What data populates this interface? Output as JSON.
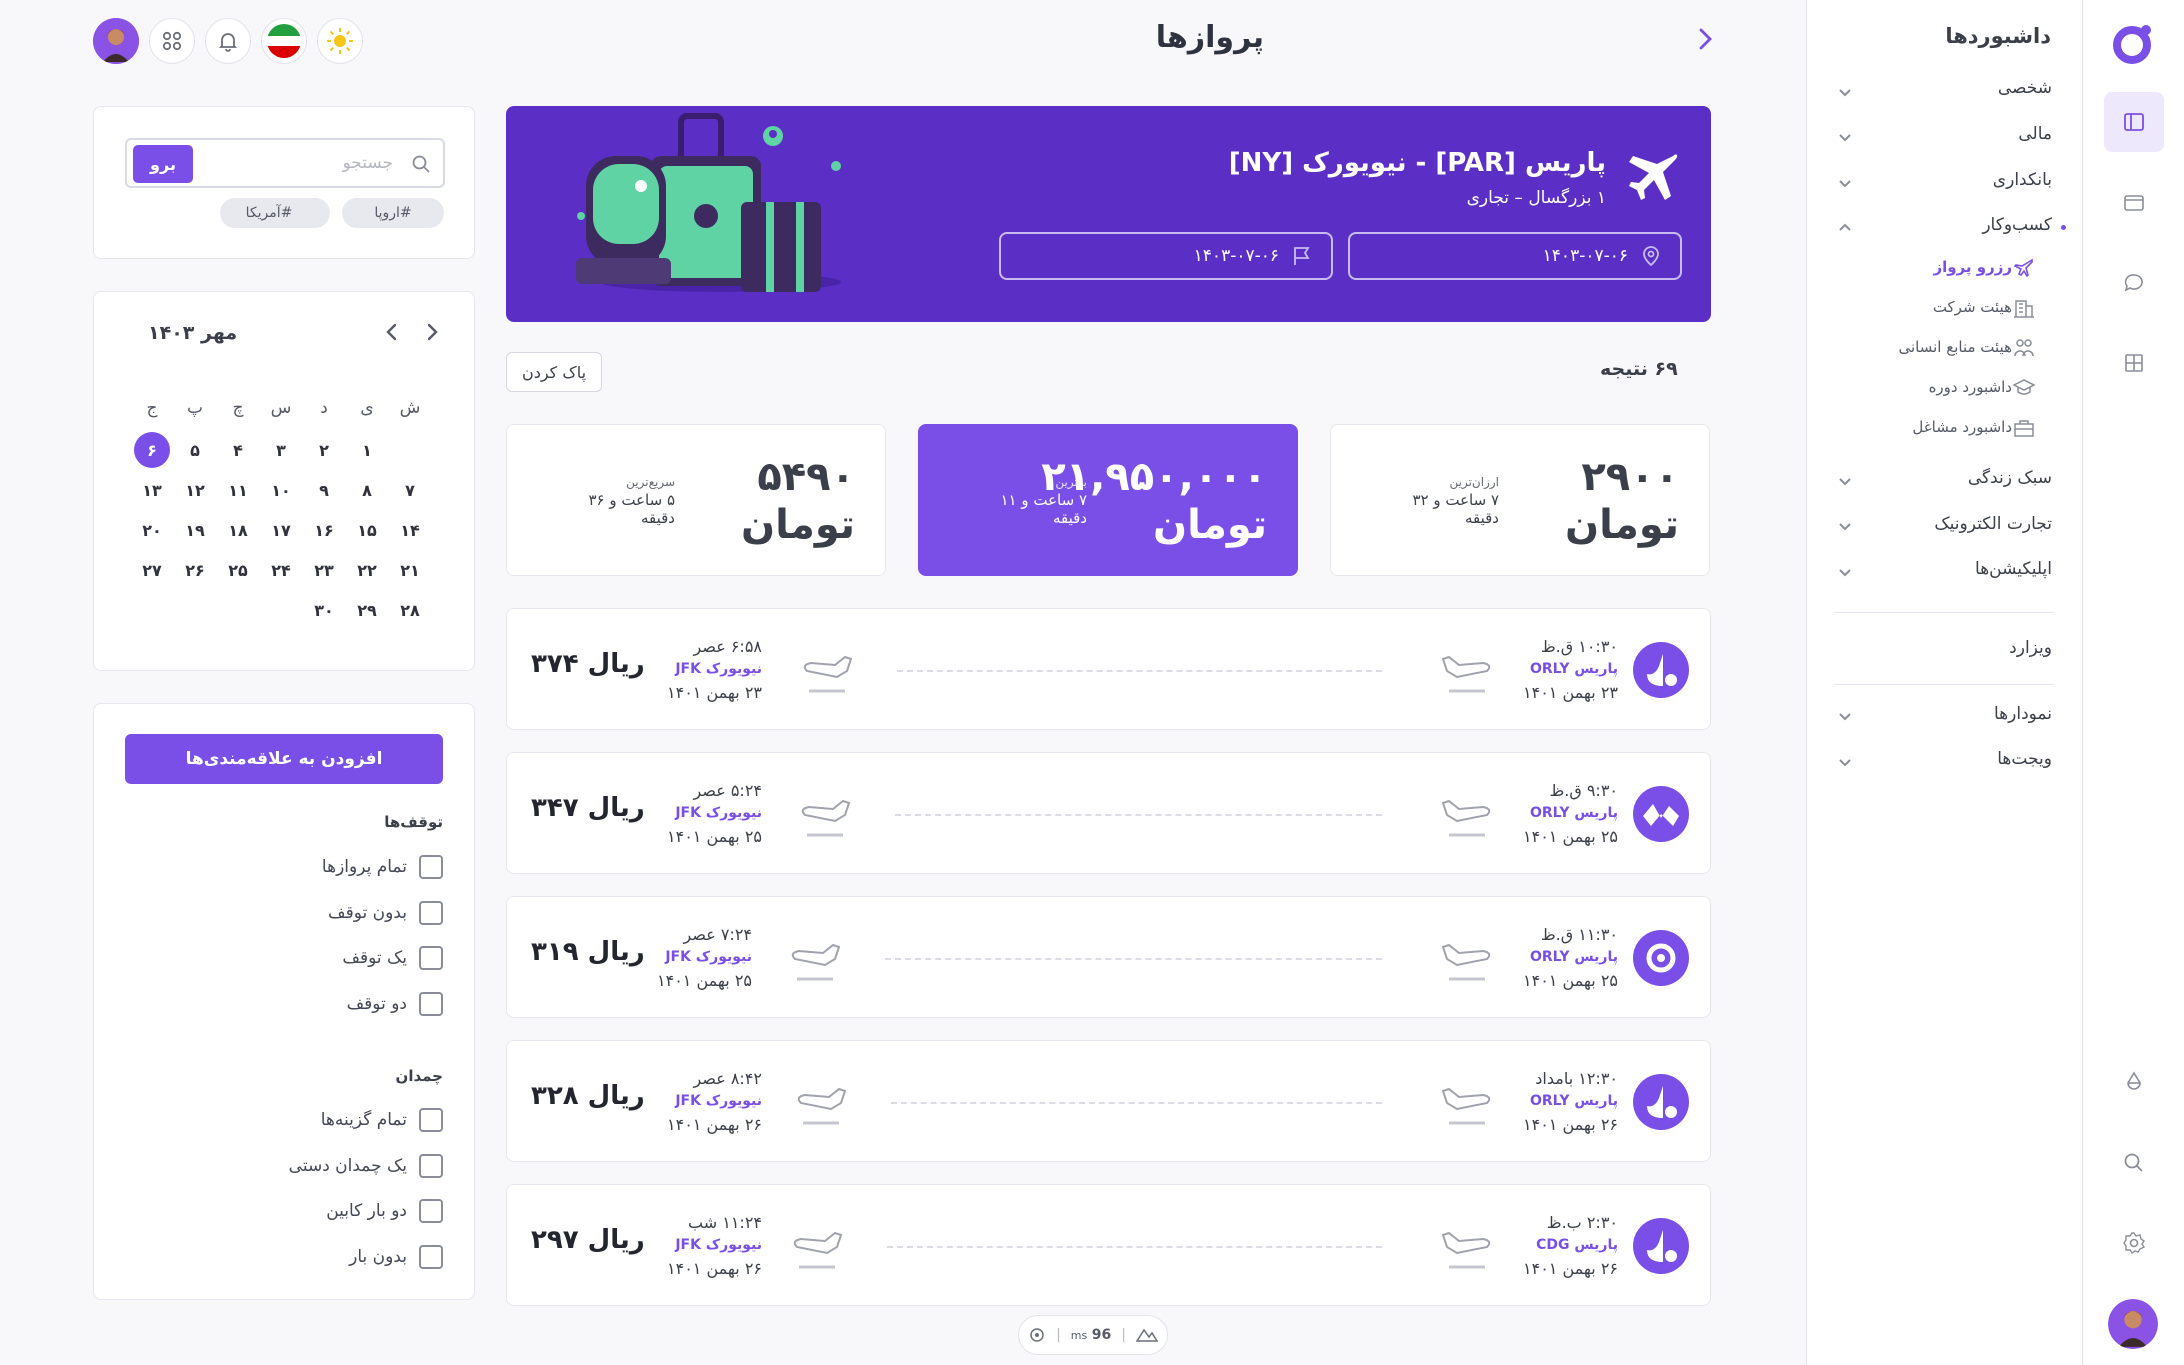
{
  "page_title": "پروازها",
  "banner": {
    "route": "پاریس [PAR] - نیویورک [NY]",
    "passengers": "۱ بزرگسال – تجاری",
    "depart_date": "۱۴۰۳-۰۷-۰۶",
    "return_date": "۱۴۰۳-۰۷-۰۶"
  },
  "results": {
    "count_text": "۶۹ نتیجه",
    "clear_label": "پاک کردن"
  },
  "summary": [
    {
      "price": "۲۹۰۰ تومان",
      "label": "ارزان‌ترین",
      "duration": "۷ ساعت و ۳۲ دقیقه"
    },
    {
      "price": "۲۱,۹۵۰,۰۰۰ تومان",
      "label": "بهترین",
      "duration": "۷ ساعت و ۱۱ دقیقه"
    },
    {
      "price": "۵۴۹۰ تومان",
      "label": "سریع‌ترین",
      "duration": "۵ ساعت و ۳۶ دقیقه"
    }
  ],
  "flights": [
    {
      "dep_time": "۱۰:۳۰ ق.ظ",
      "dep_city": "پاریس ORLY",
      "dep_date": "۲۳ بهمن ۱۴۰۱",
      "arr_time": "۶:۵۸ عصر",
      "arr_city": "نیویورک JFK",
      "arr_date": "۲۳ بهمن ۱۴۰۱",
      "price": "ریال ۳۷۴"
    },
    {
      "dep_time": "۹:۳۰ ق.ظ",
      "dep_city": "پاریس ORLY",
      "dep_date": "۲۵ بهمن ۱۴۰۱",
      "arr_time": "۵:۲۴ عصر",
      "arr_city": "نیویورک JFK",
      "arr_date": "۲۵ بهمن ۱۴۰۱",
      "price": "ریال ۳۴۷"
    },
    {
      "dep_time": "۱۱:۳۰ ق.ظ",
      "dep_city": "پاریس ORLY",
      "dep_date": "۲۵ بهمن ۱۴۰۱",
      "arr_time": "۷:۲۴ عصر",
      "arr_city": "نیویورک JFK",
      "arr_date": "۲۵ بهمن ۱۴۰۱",
      "price": "ریال ۳۱۹"
    },
    {
      "dep_time": "۱۲:۳۰ بامداد",
      "dep_city": "پاریس ORLY",
      "dep_date": "۲۶ بهمن ۱۴۰۱",
      "arr_time": "۸:۴۲ عصر",
      "arr_city": "نیویورک JFK",
      "arr_date": "۲۶ بهمن ۱۴۰۱",
      "price": "ریال ۳۲۸"
    },
    {
      "dep_time": "۲:۳۰ ب.ظ",
      "dep_city": "پاریس CDG",
      "dep_date": "۲۶ بهمن ۱۴۰۱",
      "arr_time": "۱۱:۲۴ شب",
      "arr_city": "نیویورک JFK",
      "arr_date": "۲۶ بهمن ۱۴۰۱",
      "price": "ریال ۲۹۷"
    }
  ],
  "search": {
    "placeholder": "جستجو",
    "go_label": "برو",
    "tags": [
      "#اروپا",
      "#آسیا",
      "#آمریکا"
    ]
  },
  "calendar": {
    "title": "مهر ۱۴۰۳",
    "weekdays": [
      "ش",
      "ی",
      "د",
      "س",
      "چ",
      "پ",
      "ج"
    ],
    "weeks": [
      [
        "",
        "۱",
        "۲",
        "۳",
        "۴",
        "۵",
        "۶"
      ],
      [
        "۷",
        "۸",
        "۹",
        "۱۰",
        "۱۱",
        "۱۲",
        "۱۳"
      ],
      [
        "۱۴",
        "۱۵",
        "۱۶",
        "۱۷",
        "۱۸",
        "۱۹",
        "۲۰"
      ],
      [
        "۲۱",
        "۲۲",
        "۲۳",
        "۲۴",
        "۲۵",
        "۲۶",
        "۲۷"
      ],
      [
        "۲۸",
        "۲۹",
        "۳۰",
        "",
        "",
        "",
        ""
      ]
    ],
    "selected": "۶"
  },
  "filters": {
    "fav_label": "افزودن به علاقه‌مندی‌ها",
    "stops_title": "توقف‌ها",
    "stops": [
      "تمام پروازها",
      "بدون توقف",
      "یک توقف",
      "دو توقف"
    ],
    "baggage_title": "چمدان",
    "baggage": [
      "تمام گزینه‌ها",
      "یک چمدان دستی",
      "دو بار کابین",
      "بدون بار"
    ]
  },
  "sidebar": {
    "header": "داشبوردها",
    "sections": [
      "شخصی",
      "مالی",
      "بانکداری",
      "کسب‌وکار"
    ],
    "business_items": [
      "رزرو پرواز",
      "هیئت شرکت",
      "هیئت منابع انسانی",
      "داشبورد دوره",
      "داشبورد مشاغل"
    ],
    "sections2": [
      "سبک زندگی",
      "تجارت الکترونیک",
      "اپلیکیشن‌ها"
    ],
    "wizard": "ویزارد",
    "sections3": [
      "نمودارها",
      "ویجت‌ها"
    ]
  },
  "status": {
    "latency": "96",
    "unit": "ms"
  },
  "colors": {
    "accent": "#7a4fe8",
    "banner": "#5b2fc6"
  }
}
